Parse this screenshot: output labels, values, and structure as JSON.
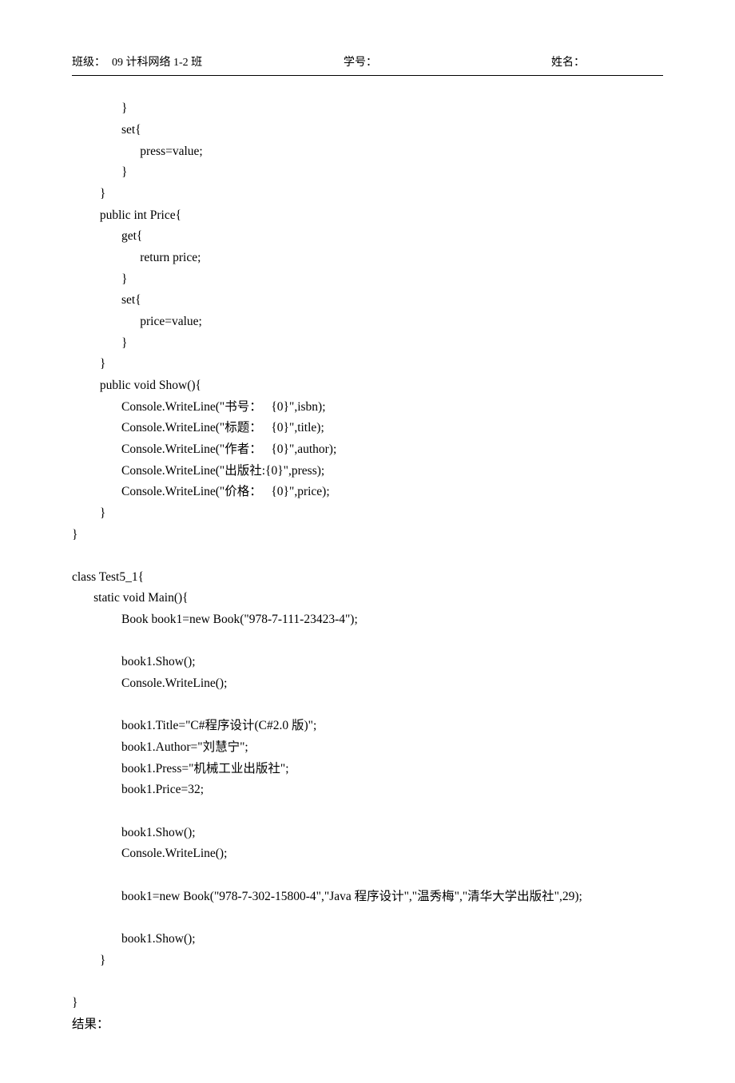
{
  "header": {
    "class_label": "班级：",
    "class_value": "09 计科网络 1-2 班",
    "id_label": "学号：",
    "name_label": "姓名："
  },
  "code": {
    "line01": "                }",
    "line02": "                set{",
    "line03": "                      press=value;",
    "line04": "                }",
    "line05": "         }",
    "line06": "         public int Price{",
    "line07": "                get{",
    "line08": "                      return price;",
    "line09": "                }",
    "line10": "                set{",
    "line11": "                      price=value;",
    "line12": "                }",
    "line13": "         }",
    "line14": "         public void Show(){",
    "line15": "                Console.WriteLine(\"书号：   {0}\",isbn);",
    "line16": "                Console.WriteLine(\"标题：   {0}\",title);",
    "line17": "                Console.WriteLine(\"作者：   {0}\",author);",
    "line18": "                Console.WriteLine(\"出版社:{0}\",press);",
    "line19": "                Console.WriteLine(\"价格：   {0}\",price);",
    "line20": "         }",
    "line21": "}",
    "line22": "",
    "line23": "class Test5_1{",
    "line24": "       static void Main(){",
    "line25": "                Book book1=new Book(\"978-7-111-23423-4\");",
    "line26": "",
    "line27": "                book1.Show();",
    "line28": "                Console.WriteLine();",
    "line29": "",
    "line30": "                book1.Title=\"C#程序设计(C#2.0 版)\";",
    "line31": "                book1.Author=\"刘慧宁\";",
    "line32": "                book1.Press=\"机械工业出版社\";",
    "line33": "                book1.Price=32;",
    "line34": "",
    "line35": "                book1.Show();",
    "line36": "                Console.WriteLine();",
    "line37": "",
    "line38": "                book1=new Book(\"978-7-302-15800-4\",\"Java 程序设计\",\"温秀梅\",\"清华大学出版社\",29);",
    "line39": "",
    "line40": "                book1.Show();",
    "line41": "         }",
    "line42": "",
    "line43": "}",
    "line44": "结果："
  }
}
